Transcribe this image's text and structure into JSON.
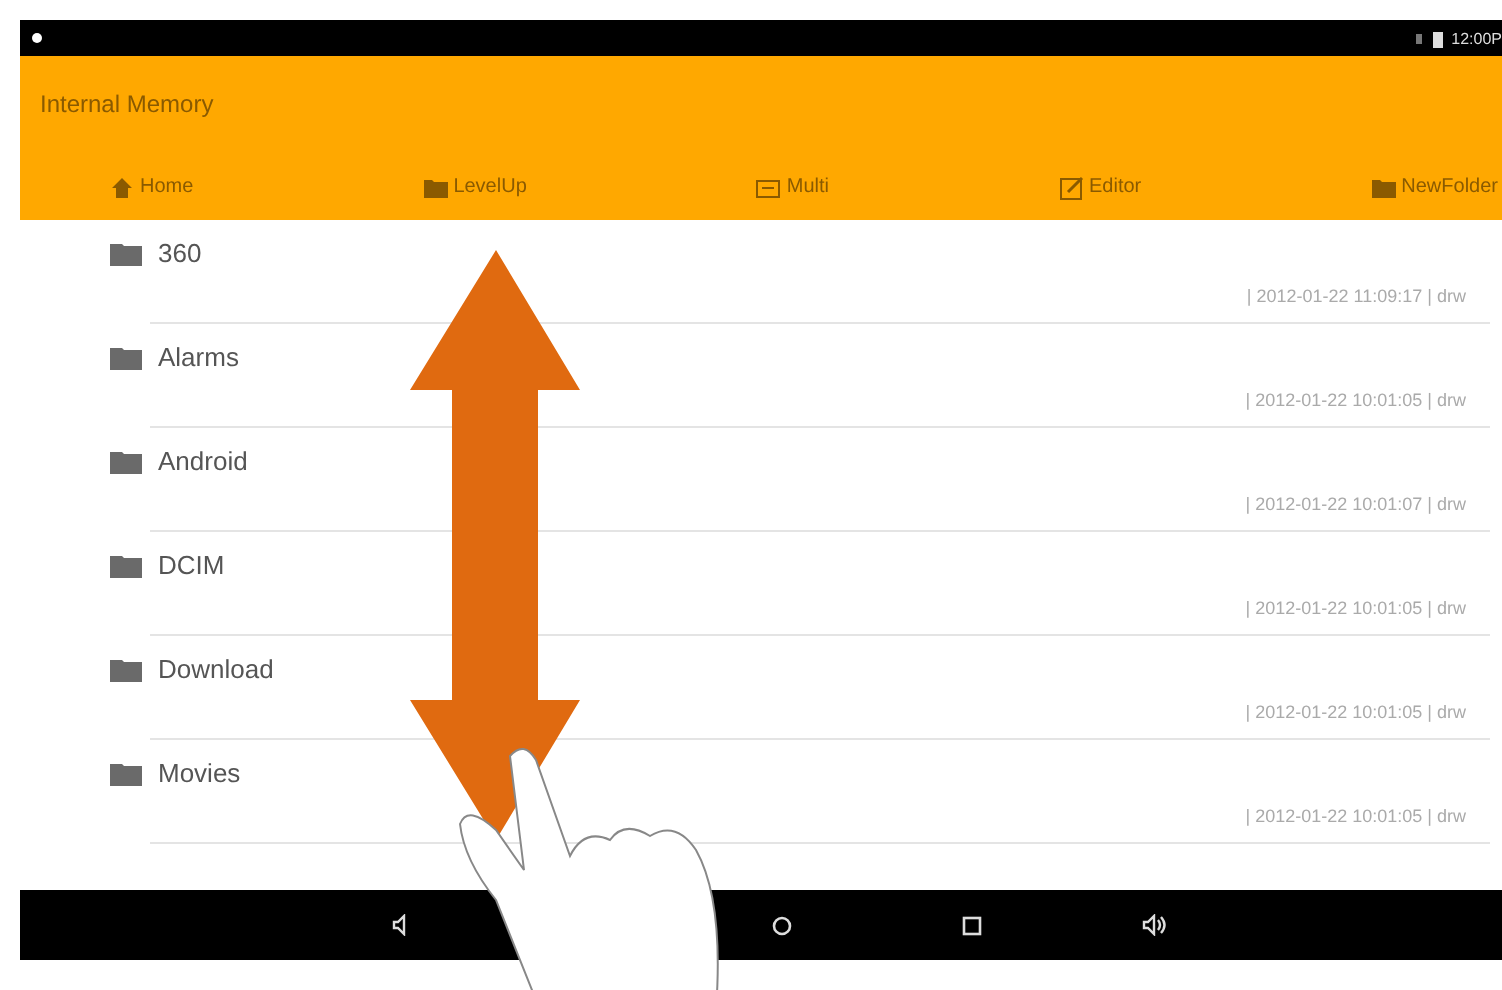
{
  "status_bar": {
    "time": "12:00P"
  },
  "header": {
    "title": "Internal Memory"
  },
  "toolbar": [
    {
      "label": "Home",
      "kind": "home"
    },
    {
      "label": "LevelUp",
      "kind": "folder"
    },
    {
      "label": "Multi",
      "kind": "multi"
    },
    {
      "label": "Editor",
      "kind": "edit"
    },
    {
      "label": "NewFolder",
      "kind": "folder"
    }
  ],
  "files": [
    {
      "name": "360",
      "info": "| 2012-01-22 11:09:17 | drw"
    },
    {
      "name": "Alarms",
      "info": "| 2012-01-22 10:01:05 | drw"
    },
    {
      "name": "Android",
      "info": "| 2012-01-22 10:01:07 | drw"
    },
    {
      "name": "DCIM",
      "info": "| 2012-01-22 10:01:05 | drw"
    },
    {
      "name": "Download",
      "info": "| 2012-01-22 10:01:05 | drw"
    },
    {
      "name": "Movies",
      "info": "| 2012-01-22 10:01:05 | drw"
    }
  ]
}
